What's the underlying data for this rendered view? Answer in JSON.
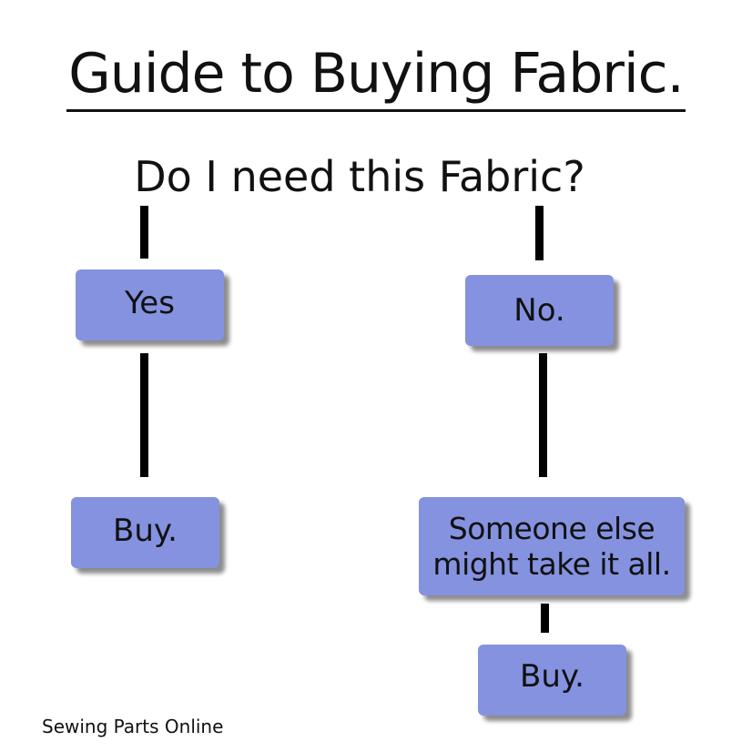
{
  "title": "Guide to Buying Fabric.",
  "question": "Do I need this Fabric?",
  "left_branch": {
    "answer": "Yes",
    "result": "Buy."
  },
  "right_branch": {
    "answer": "No.",
    "reason_line1": "Someone else",
    "reason_line2": "might take it all.",
    "result": "Buy."
  },
  "footer": "Sewing Parts Online",
  "colors": {
    "box_fill": "#8592e0",
    "connector": "#000000",
    "text": "#111111"
  }
}
